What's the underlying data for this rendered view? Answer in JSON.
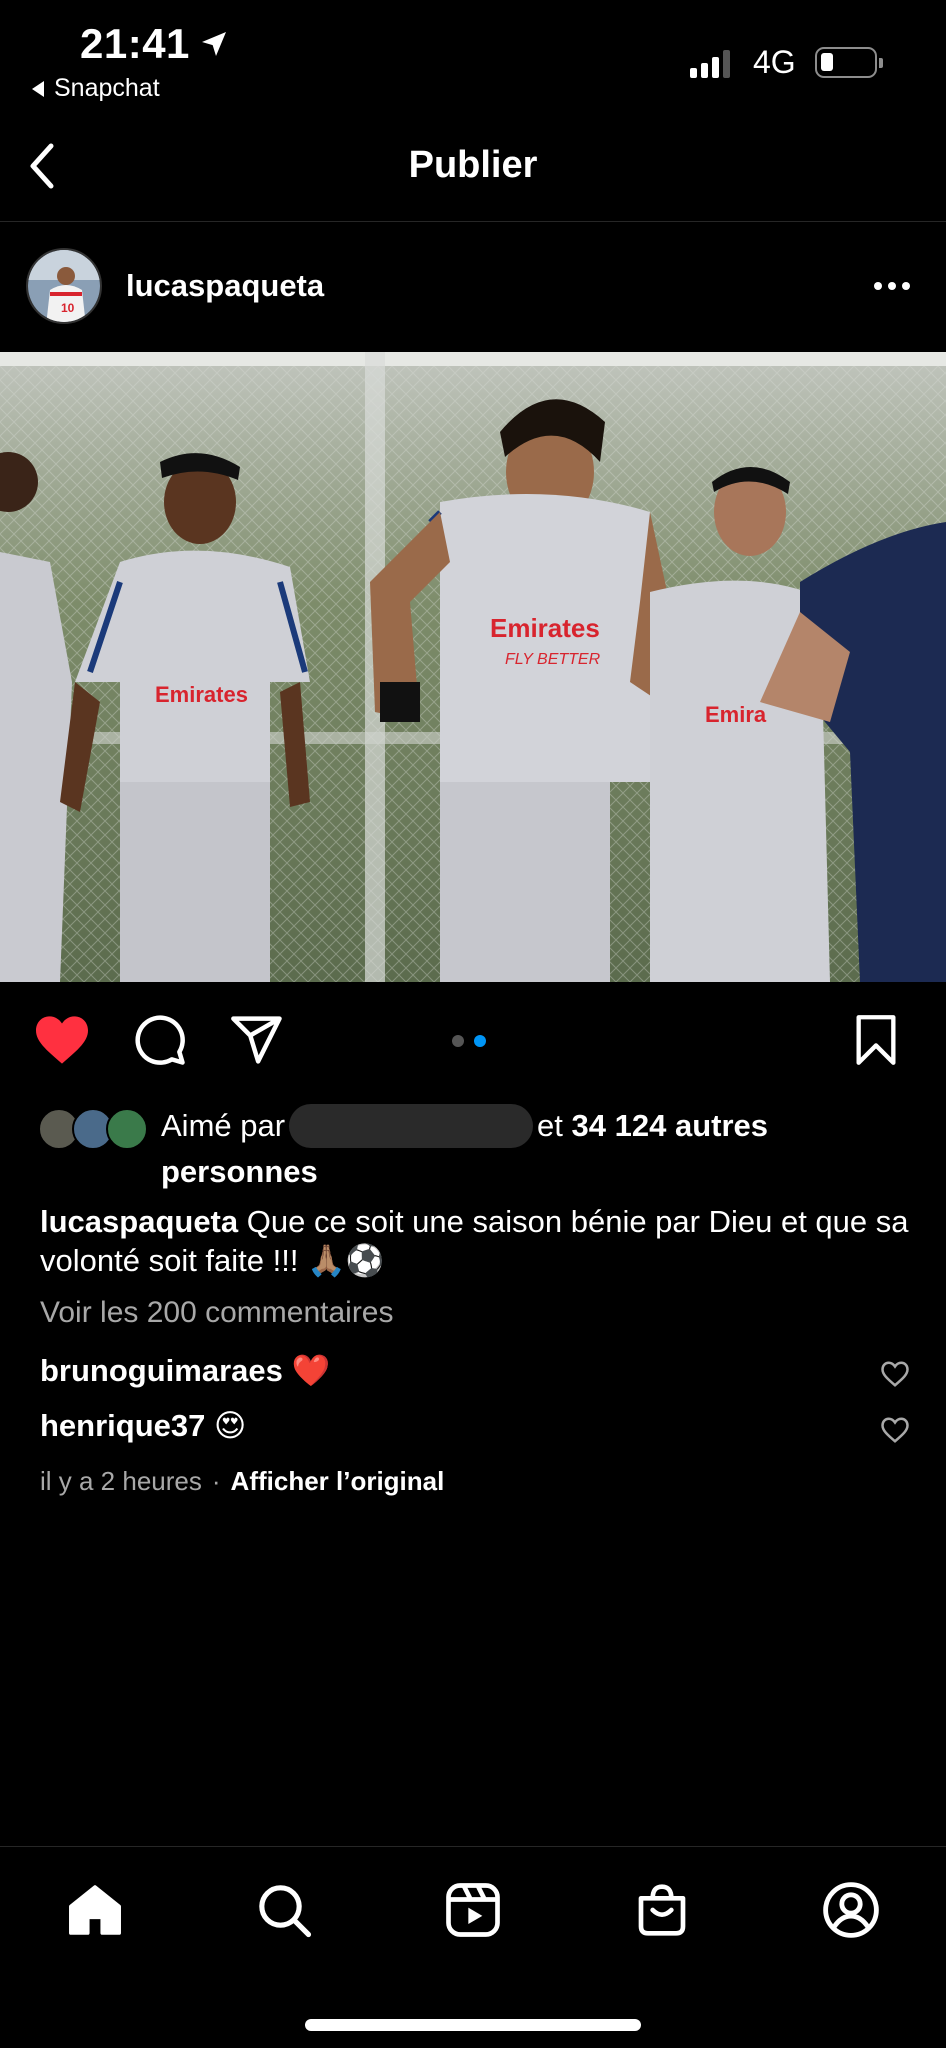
{
  "status_bar": {
    "time": "21:41",
    "back_app": "Snapchat",
    "network": "4G",
    "battery_level": 0.2
  },
  "header": {
    "title": "Publier"
  },
  "post": {
    "username": "lucaspaqueta",
    "image_alt": "Lyon players training in grey Emirates Fly Better kits",
    "carousel": {
      "total": 2,
      "active": 2
    },
    "liked": true,
    "likes": {
      "prefix": "Aimé par",
      "middle": "et",
      "count": "34 124 autres",
      "suffix": "personnes"
    },
    "caption": {
      "username": "lucaspaqueta",
      "text": "Que ce soit une saison bénie par Dieu et que sa volonté soit faite !!! 🙏🏽⚽"
    },
    "view_comments": "Voir les 200 commentaires",
    "comments": [
      {
        "username": "brunoguimaraes",
        "text": "❤️"
      },
      {
        "username": "henrique37",
        "text": "😍"
      }
    ],
    "time_ago": "il y a 2 heures",
    "separator": "·",
    "show_original": "Afficher l’original"
  },
  "colors": {
    "background": "#000000",
    "like_red": "#ff3040",
    "carousel_active": "#0095f6",
    "carousel_inactive": "#555555",
    "secondary_text": "#a8a8a8"
  },
  "tabbar": {
    "items": [
      "home-icon",
      "search-icon",
      "reels-icon",
      "shop-icon",
      "profile-icon"
    ]
  }
}
